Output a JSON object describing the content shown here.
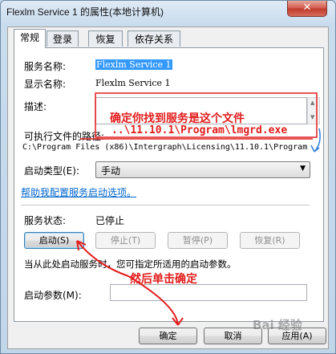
{
  "window": {
    "title": "Flexlm Service 1 的属性(本地计算机)",
    "close_symbol": "✕"
  },
  "tabs": [
    {
      "label": "常规",
      "active": true
    },
    {
      "label": "登录",
      "active": false
    },
    {
      "label": "恢复",
      "active": false
    },
    {
      "label": "依存关系",
      "active": false
    }
  ],
  "general": {
    "service_name_label": "服务名称:",
    "service_name_value": "Flexlm Service 1",
    "display_name_label": "显示名称:",
    "display_name_value": "Flexlm Service 1",
    "description_label": "描述:",
    "exe_path_label": "可执行文件的路径:",
    "exe_path_value": "C:\\Program Files (x86)\\Intergraph\\Licensing\\11.10.1\\Program",
    "startup_type_label": "启动类型(E):",
    "startup_type_value": "手动",
    "help_link": "帮助我配置服务启动选项。",
    "status_label": "服务状态:",
    "status_value": "已停止",
    "buttons": {
      "start": "启动(S)",
      "stop": "停止(T)",
      "pause": "暂停(P)",
      "resume": "恢复(R)"
    },
    "hint_text": "当从此处启动服务时，您可指定所适用的启动参数。",
    "start_params_label": "启动参数(M):"
  },
  "footer": {
    "ok": "确定",
    "cancel": "取消",
    "apply": "应用(A)"
  },
  "annotations": {
    "note1_line1": "确定你找到服务是这个文件",
    "note1_line2": "..\\11.10.1\\Program\\lmgrd.exe",
    "note2": "然后单击确定",
    "color": "#e31c1c",
    "arrow_blue": "#2f7fd8"
  },
  "watermark": "Bai 经验"
}
